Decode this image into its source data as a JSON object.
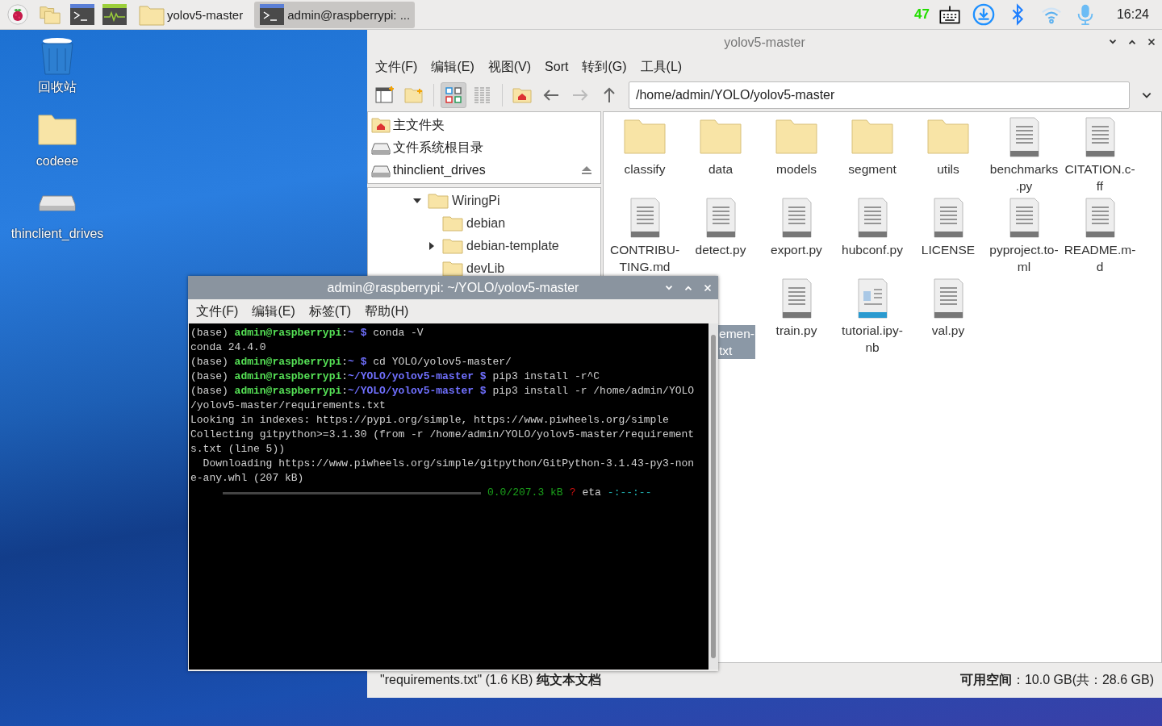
{
  "panel": {
    "launchers": [
      {
        "kind": "raspberry"
      },
      {
        "kind": "files"
      },
      {
        "kind": "terminal"
      },
      {
        "kind": "monitor"
      }
    ],
    "tasks": [
      {
        "kind": "folder",
        "label": "yolov5-master",
        "selected": false
      },
      {
        "kind": "terminal",
        "label": "admin@raspberrypi: ...",
        "selected": true
      }
    ],
    "cpu": "47",
    "clock": "16:24"
  },
  "desktop_icons": [
    {
      "kind": "trash",
      "label": "回收站"
    },
    {
      "kind": "folder",
      "label": "codeee"
    },
    {
      "kind": "drive",
      "label": "thinclient_drives"
    }
  ],
  "file_manager": {
    "title": "yolov5-master",
    "menu": [
      "文件(F)",
      "编辑(E)",
      "视图(V)",
      "Sort",
      "转到(G)",
      "工具(L)"
    ],
    "toolbar": [
      {
        "kind": "new-window"
      },
      {
        "kind": "new-folder"
      },
      {
        "kind": "icon-view",
        "selected": true
      },
      {
        "kind": "list-view",
        "selected": false
      },
      {
        "kind": "home"
      },
      {
        "kind": "back",
        "disabled": false
      },
      {
        "kind": "forward",
        "disabled": true
      },
      {
        "kind": "up"
      }
    ],
    "path": "/home/admin/YOLO/yolov5-master",
    "places": [
      {
        "kind": "home",
        "label": "主文件夹"
      },
      {
        "kind": "drive",
        "label": "文件系统根目录"
      },
      {
        "kind": "drive-eject",
        "label": "thinclient_drives"
      }
    ],
    "tree": [
      {
        "label": "WiringPi",
        "expanded": true,
        "children": [
          {
            "label": "debian"
          },
          {
            "label": "debian-template",
            "expanded": false
          },
          {
            "label": "devLib"
          }
        ]
      }
    ],
    "files": [
      {
        "kind": "folder",
        "lines": [
          "classify"
        ],
        "selected": false
      },
      {
        "kind": "folder",
        "lines": [
          "data"
        ],
        "selected": false
      },
      {
        "kind": "folder",
        "lines": [
          "models"
        ],
        "selected": false
      },
      {
        "kind": "folder",
        "lines": [
          "segment"
        ],
        "selected": false
      },
      {
        "kind": "folder",
        "lines": [
          "utils"
        ],
        "selected": false
      },
      {
        "kind": "text",
        "lines": [
          "benchmarks",
          ".py"
        ],
        "selected": false
      },
      {
        "kind": "text",
        "lines": [
          "CITATION.c-",
          "ff"
        ],
        "selected": false
      },
      {
        "kind": "text",
        "lines": [
          "CONTRIBU-",
          "TING.md"
        ],
        "selected": false
      },
      {
        "kind": "text",
        "lines": [
          "detect.py"
        ],
        "selected": false
      },
      {
        "kind": "text",
        "lines": [
          "export.py"
        ],
        "selected": false
      },
      {
        "kind": "text",
        "lines": [
          "hubconf.py"
        ],
        "selected": false
      },
      {
        "kind": "text",
        "lines": [
          "LICENSE"
        ],
        "selected": false
      },
      {
        "kind": "text",
        "lines": [
          "pyproject.to-",
          "ml"
        ],
        "selected": false
      },
      {
        "kind": "text",
        "lines": [
          "README.m-",
          "d"
        ],
        "selected": false
      },
      {
        "kind": "partial",
        "lines": [
          "emen-",
          "txt"
        ],
        "selected": true
      },
      {
        "kind": "text",
        "lines": [
          "train.py"
        ],
        "selected": false
      },
      {
        "kind": "notebook",
        "lines": [
          "tutorial.ipy-",
          "nb"
        ],
        "selected": false
      },
      {
        "kind": "text",
        "lines": [
          "val.py"
        ],
        "selected": false
      }
    ],
    "status_left": "\"requirements.txt\" (1.6 KB) **纯文本文档**",
    "status_right": "**可用空间**：10.0 GB(共：28.6 GB)"
  },
  "terminal": {
    "title": "admin@raspberrypi: ~/YOLO/yolov5-master",
    "menu": [
      "文件(F)",
      "编辑(E)",
      "标签(T)",
      "帮助(H)"
    ],
    "lines": [
      [
        {
          "kind": "plain",
          "text": "(base) "
        },
        {
          "kind": "user",
          "text": "admin@raspberrypi"
        },
        {
          "kind": "plain",
          "text": ":"
        },
        {
          "kind": "path",
          "text": "~ $"
        },
        {
          "kind": "plain",
          "text": " conda -V"
        }
      ],
      [
        {
          "kind": "plain",
          "text": "conda 24.4.0"
        }
      ],
      [
        {
          "kind": "plain",
          "text": "(base) "
        },
        {
          "kind": "user",
          "text": "admin@raspberrypi"
        },
        {
          "kind": "plain",
          "text": ":"
        },
        {
          "kind": "path",
          "text": "~ $"
        },
        {
          "kind": "plain",
          "text": " cd YOLO/yolov5-master/"
        }
      ],
      [
        {
          "kind": "plain",
          "text": "(base) "
        },
        {
          "kind": "user",
          "text": "admin@raspberrypi"
        },
        {
          "kind": "plain",
          "text": ":"
        },
        {
          "kind": "path",
          "text": "~/YOLO/yolov5-master $"
        },
        {
          "kind": "plain",
          "text": " pip3 install -r^C"
        }
      ],
      [
        {
          "kind": "plain",
          "text": "(base) "
        },
        {
          "kind": "user",
          "text": "admin@raspberrypi"
        },
        {
          "kind": "plain",
          "text": ":"
        },
        {
          "kind": "path",
          "text": "~/YOLO/yolov5-master $"
        },
        {
          "kind": "plain",
          "text": " pip3 install -r /home/admin/YOLO"
        }
      ],
      [
        {
          "kind": "plain",
          "text": "/yolov5-master/requirements.txt"
        }
      ],
      [
        {
          "kind": "plain",
          "text": "Looking in indexes: https://pypi.org/simple, https://www.piwheels.org/simple"
        }
      ],
      [
        {
          "kind": "plain",
          "text": "Collecting gitpython>=3.1.30 (from -r /home/admin/YOLO/yolov5-master/requirement"
        }
      ],
      [
        {
          "kind": "plain",
          "text": "s.txt (line 5))"
        }
      ],
      [
        {
          "kind": "plain",
          "text": "  Downloading https://www.piwheels.org/simple/gitpython/GitPython-3.1.43-py3-non"
        }
      ],
      [
        {
          "kind": "plain",
          "text": "e-any.whl (207 kB)"
        }
      ]
    ],
    "progress": {
      "level": 0,
      "size": "0.0/207.3 kB",
      "rate": "?",
      "eta_label": "eta",
      "eta": "-:--:--"
    }
  }
}
